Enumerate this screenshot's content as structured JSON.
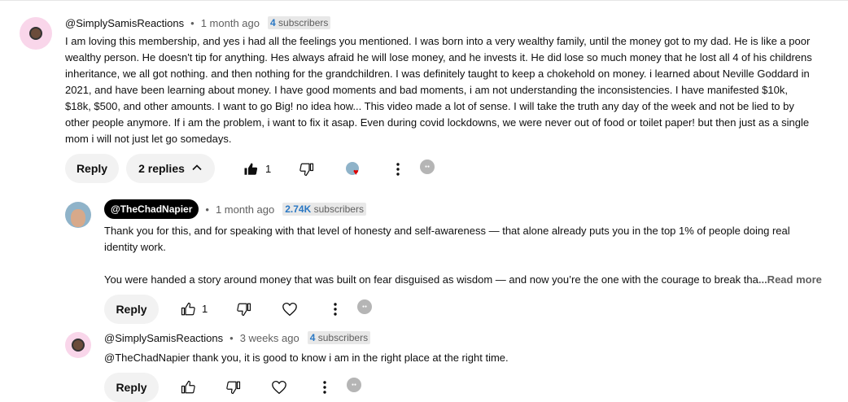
{
  "top_comment": {
    "handle": "@SimplySamisReactions",
    "time": "1 month ago",
    "subs_count": "4",
    "subs_label": "subscribers",
    "lines": [
      "I am loving this membership, and yes i had all the feelings you mentioned. I was born into a very wealthy family, until the money got to my dad. He is like a poor",
      "wealthy person. He doesn't tip for anything. Hes always afraid he will lose money, and he invests it. He did lose so much money that he lost all 4 of his childrens",
      "inheritance, we all got nothing. and then nothing for the grandchildren. I was definitely taught to keep a chokehold on money. i learned about Neville Goddard in",
      "2021, and have been learning about money. I have good moments and bad moments, i am not understanding the inconsistencies. I have manifested $10k,",
      "$18k, $500, and other amounts. I want to go Big! no idea how... This video made a lot of sense. I will take the truth any day of the week and not be lied to by",
      "other people anymore. If i am the problem, i want to fix it asap. Even during covid lockdowns, we were never out of food or toilet paper! but then just as a single",
      "mom i will not just let go somedays."
    ],
    "reply_label": "Reply",
    "replies_label": "2 replies",
    "like_count": "1"
  },
  "reply_1": {
    "handle": "@TheChadNapier",
    "time": "1 month ago",
    "subs_count": "2.74K",
    "subs_label": "subscribers",
    "lines": [
      "Thank you for this, and for speaking with that level of honesty and self-awareness — that alone already puts you in the top 1% of people doing real",
      "identity work."
    ],
    "last_line": "You were handed a story around money that was built on fear disguised as wisdom — and now you’re the one with the courage to break tha",
    "read_more": "...Read more",
    "reply_label": "Reply",
    "like_count": "1"
  },
  "reply_2": {
    "handle": "@SimplySamisReactions",
    "time": "3 weeks ago",
    "subs_count": "4",
    "subs_label": "subscribers",
    "text": "@TheChadNapier thank you, it is good to know i am in the right place at the right time.",
    "reply_label": "Reply"
  },
  "colors": {
    "accent_blue": "#2a78c4",
    "heart_red": "#dd0000"
  },
  "icons": [
    "thumbs-up-icon",
    "thumbs-down-icon",
    "heart-icon",
    "more-vert-icon",
    "chevron-up-icon"
  ]
}
